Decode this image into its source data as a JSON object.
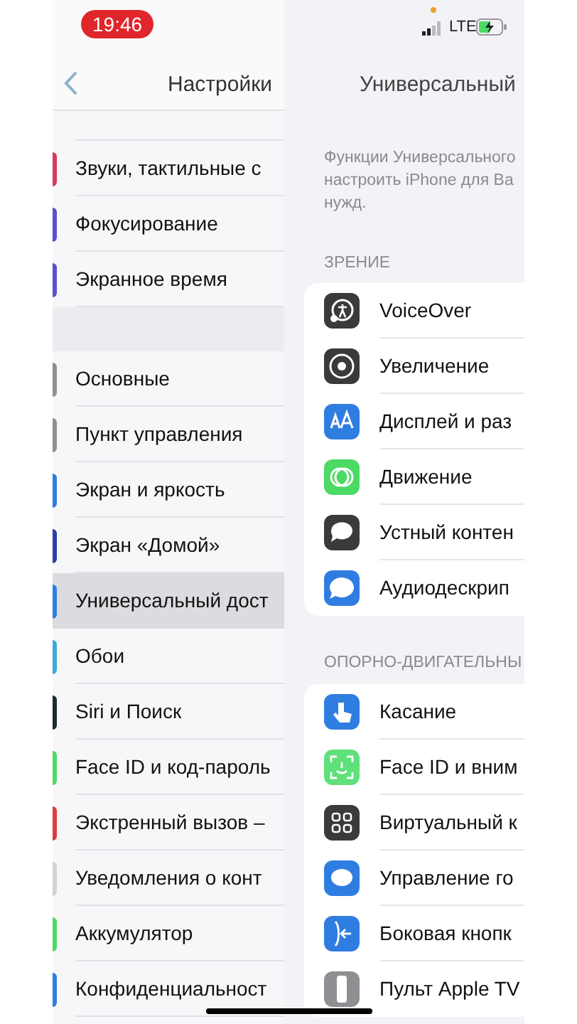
{
  "status_bar": {
    "time": "19:46",
    "network": "LTE"
  },
  "settings_pane": {
    "title": "Настройки",
    "groups": [
      {
        "items": [
          {
            "label": "Звуки, тактильные с",
            "color": "#d63a5c",
            "selected": false
          },
          {
            "label": "Фокусирование",
            "color": "#5a4fcf",
            "selected": false
          },
          {
            "label": "Экранное время",
            "color": "#5a4fcf",
            "selected": false
          }
        ]
      },
      {
        "items": [
          {
            "label": "Основные",
            "color": "#8e8e93",
            "selected": false
          },
          {
            "label": "Пункт управления",
            "color": "#8e8e93",
            "selected": false
          },
          {
            "label": "Экран и яркость",
            "color": "#2f7de1",
            "selected": false
          },
          {
            "label": "Экран «Домой»",
            "color": "#2a3fa8",
            "selected": false
          },
          {
            "label": "Универсальный дост",
            "color": "#2f7de1",
            "selected": true
          },
          {
            "label": "Обои",
            "color": "#3fa9d8",
            "selected": false
          },
          {
            "label": "Siri и Поиск",
            "color": "#1c2b2b",
            "selected": false
          },
          {
            "label": "Face ID и код-пароль",
            "color": "#4cd964",
            "selected": false
          },
          {
            "label": "Экстренный вызов –",
            "color": "#e0393e",
            "selected": false
          },
          {
            "label": "Уведомления о конт",
            "color": "#d1d1d6",
            "selected": false
          },
          {
            "label": "Аккумулятор",
            "color": "#4cd964",
            "selected": false
          },
          {
            "label": "Конфиденциальност",
            "color": "#2f7de1",
            "selected": false
          }
        ]
      }
    ]
  },
  "detail_pane": {
    "title": "Универсальный",
    "description": "Функции Универсального\nнастроить iPhone для Ва\nнужд.",
    "sections": [
      {
        "header": "ЗРЕНИЕ",
        "items": [
          {
            "label": "VoiceOver",
            "color": "#3a3a3c"
          },
          {
            "label": "Увеличение",
            "color": "#3a3a3c"
          },
          {
            "label": "Дисплей и раз",
            "color": "#2f7de1"
          },
          {
            "label": "Движение",
            "color": "#4cd964"
          },
          {
            "label": "Устный контен",
            "color": "#3a3a3c"
          },
          {
            "label": "Аудиодескрип",
            "color": "#2f7de1"
          }
        ]
      },
      {
        "header": "ОПОРНО-ДВИГАТЕЛЬНЫ",
        "items": [
          {
            "label": "Касание",
            "color": "#2f7de1"
          },
          {
            "label": "Face ID и вним",
            "color": "#5fe07a"
          },
          {
            "label": "Виртуальный к",
            "color": "#3a3a3c"
          },
          {
            "label": "Управление го",
            "color": "#2f7de1"
          },
          {
            "label": "Боковая кнопк",
            "color": "#2f7de1"
          },
          {
            "label": "Пульт Apple TV",
            "color": "#8e8e93"
          }
        ]
      }
    ]
  }
}
